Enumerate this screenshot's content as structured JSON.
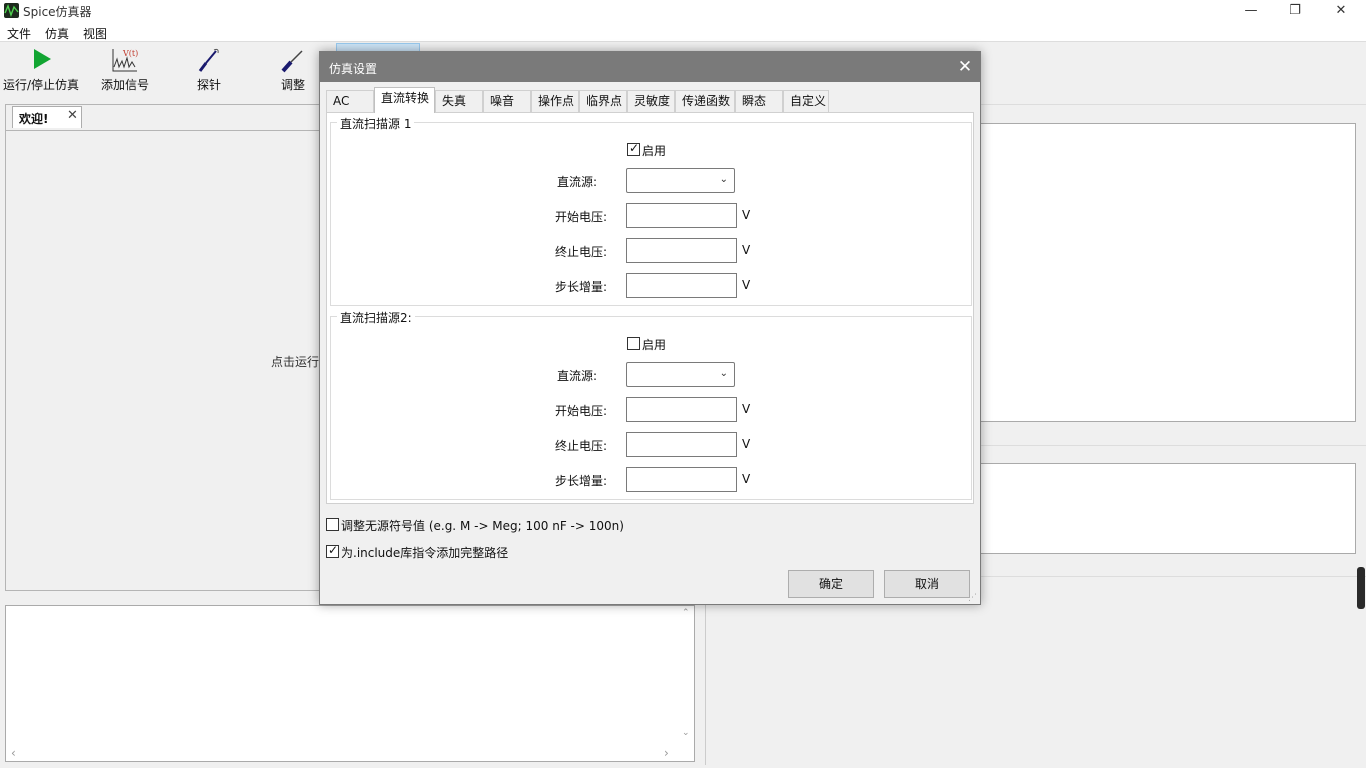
{
  "window": {
    "title": "Spice仿真器",
    "minimize": "—",
    "restore": "❐",
    "close": "✕"
  },
  "menu": [
    "文件",
    "仿真",
    "视图"
  ],
  "toolbar": {
    "run": "运行/停止仿真",
    "add_signal": "添加信号",
    "probe": "探针",
    "tune": "调整"
  },
  "doc": {
    "tab_label": "欢迎!",
    "tab_close": "✕",
    "hint": "点击运行"
  },
  "dialog": {
    "title": "仿真设置",
    "close": "✕",
    "tabs": [
      "AC",
      "直流转换",
      "失真",
      "噪音",
      "操作点",
      "临界点",
      "灵敏度",
      "传递函数",
      "瞬态",
      "自定义"
    ],
    "active_tab": "直流转换",
    "source1": {
      "title": "直流扫描源 1",
      "enable_label": "启用",
      "enabled": true,
      "source_label": "直流源:",
      "source_value": "",
      "start_label": "开始电压:",
      "start_value": "",
      "stop_label": "终止电压:",
      "stop_value": "",
      "step_label": "步长增量:",
      "step_value": "",
      "unit": "V"
    },
    "source2": {
      "title": "直流扫描源2:",
      "enable_label": "启用",
      "enabled": false,
      "source_label": "直流源:",
      "source_value": "",
      "start_label": "开始电压:",
      "start_value": "",
      "stop_label": "终止电压:",
      "stop_value": "",
      "step_label": "步长增量:",
      "step_value": "",
      "unit": "V"
    },
    "option_passive": "调整无源符号值 (e.g. M -> Meg; 100 nF -> 100n)",
    "option_passive_checked": false,
    "option_include": "为.include库指令添加完整路径",
    "option_include_checked": true,
    "ok": "确定",
    "cancel": "取消"
  },
  "icons": {
    "check": "✓",
    "chevron": "⌄",
    "up": "⌃",
    "down": "⌄",
    "left": "‹",
    "right": "›"
  }
}
